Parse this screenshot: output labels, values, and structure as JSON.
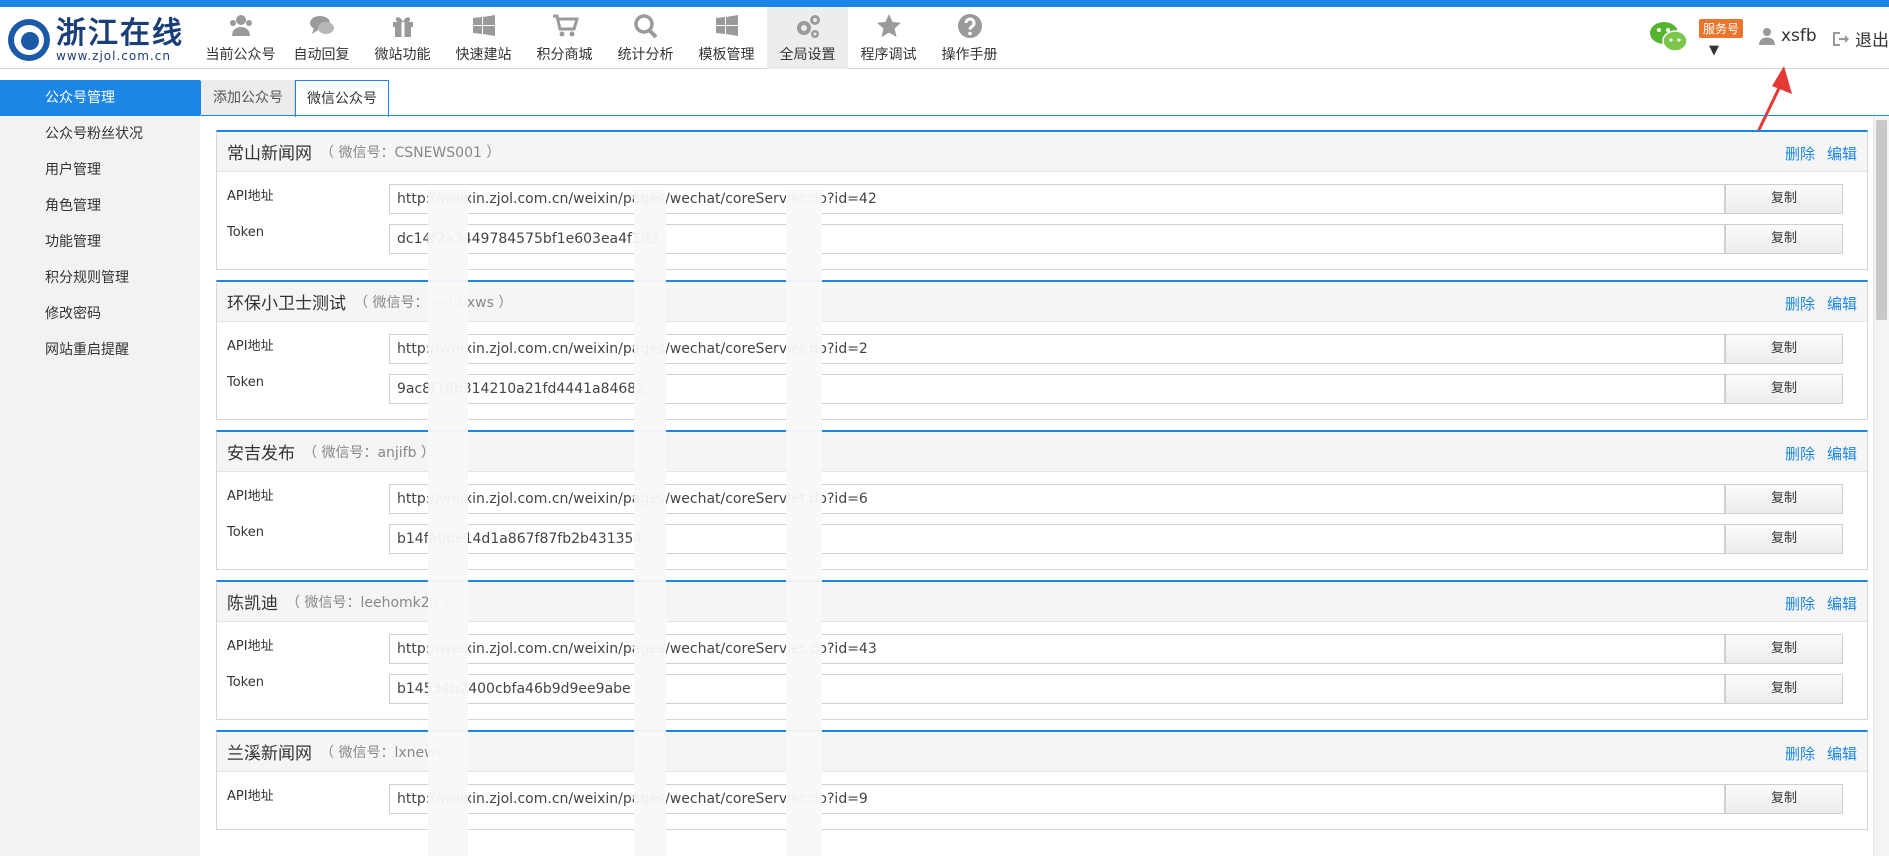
{
  "brand": {
    "name_cn": "浙江在线",
    "url": "www.zjol.com.cn"
  },
  "nav": [
    {
      "label": "当前公众号",
      "icon": "user-group-icon"
    },
    {
      "label": "自动回复",
      "icon": "chat-bubble-icon"
    },
    {
      "label": "微站功能",
      "icon": "gift-icon"
    },
    {
      "label": "快速建站",
      "icon": "windows-icon"
    },
    {
      "label": "积分商城",
      "icon": "cart-icon"
    },
    {
      "label": "统计分析",
      "icon": "search-icon"
    },
    {
      "label": "模板管理",
      "icon": "windows-icon"
    },
    {
      "label": "全局设置",
      "icon": "gears-icon",
      "active": true
    },
    {
      "label": "程序调试",
      "icon": "star-icon"
    },
    {
      "label": "操作手册",
      "icon": "help-icon"
    }
  ],
  "header_right": {
    "service_badge": "服务号",
    "caret": "▼",
    "username": "xsfb",
    "logout": "退出"
  },
  "sidebar": [
    {
      "label": "公众号管理",
      "active": true
    },
    {
      "label": "公众号粉丝状况"
    },
    {
      "label": "用户管理"
    },
    {
      "label": "角色管理"
    },
    {
      "label": "功能管理"
    },
    {
      "label": "积分规则管理"
    },
    {
      "label": "修改密码"
    },
    {
      "label": "网站重启提醒"
    }
  ],
  "tabs": [
    {
      "label": "添加公众号"
    },
    {
      "label": "微信公众号",
      "active": true
    }
  ],
  "labels": {
    "api": "API地址",
    "token": "Token",
    "copy": "复制",
    "delete": "删除",
    "edit": "编辑"
  },
  "accounts": [
    {
      "name": "常山新闻网",
      "wx": "（ 微信号：CSNEWS001 ）",
      "api": "http://weixin.zjol.com.cn/weixin/pages/wechat/coreServlet.do?id=42",
      "token": "dc14f2a3449784575bf1e603ea4f1d3"
    },
    {
      "name": "环保小卫士测试",
      "wx": "（ 微信号：xs-hbxws ）",
      "api": "http://weixin.zjol.com.cn/weixin/pages/wechat/coreServlet.do?id=2",
      "token": "9ac8f18b314210a21fd4441a84682"
    },
    {
      "name": "安吉发布",
      "wx": "（ 微信号：anjifb ）",
      "api": "http://weixin.zjol.com.cn/weixin/pages/wechat/coreServlet.do?id=6",
      "token": "b14fa0be14d1a867f87fb2b431354"
    },
    {
      "name": "陈凯迪",
      "wx": "（ 微信号：leehomk20 ）",
      "api": "http://weixin.zjol.com.cn/weixin/pages/wechat/coreServlet.do?id=43",
      "token": "b14534b2400cbfa46b9d9ee9abe"
    },
    {
      "name": "兰溪新闻网",
      "wx": "（ 微信号：lxnews ）",
      "api": "http://weixin.zjol.com.cn/weixin/pages/wechat/coreServlet.do?id=9",
      "token": ""
    }
  ],
  "colors": {
    "accent": "#1c86e6",
    "link": "#1c86e6",
    "badge": "#e9762c",
    "sidebar_bg": "#f2f2f2"
  }
}
